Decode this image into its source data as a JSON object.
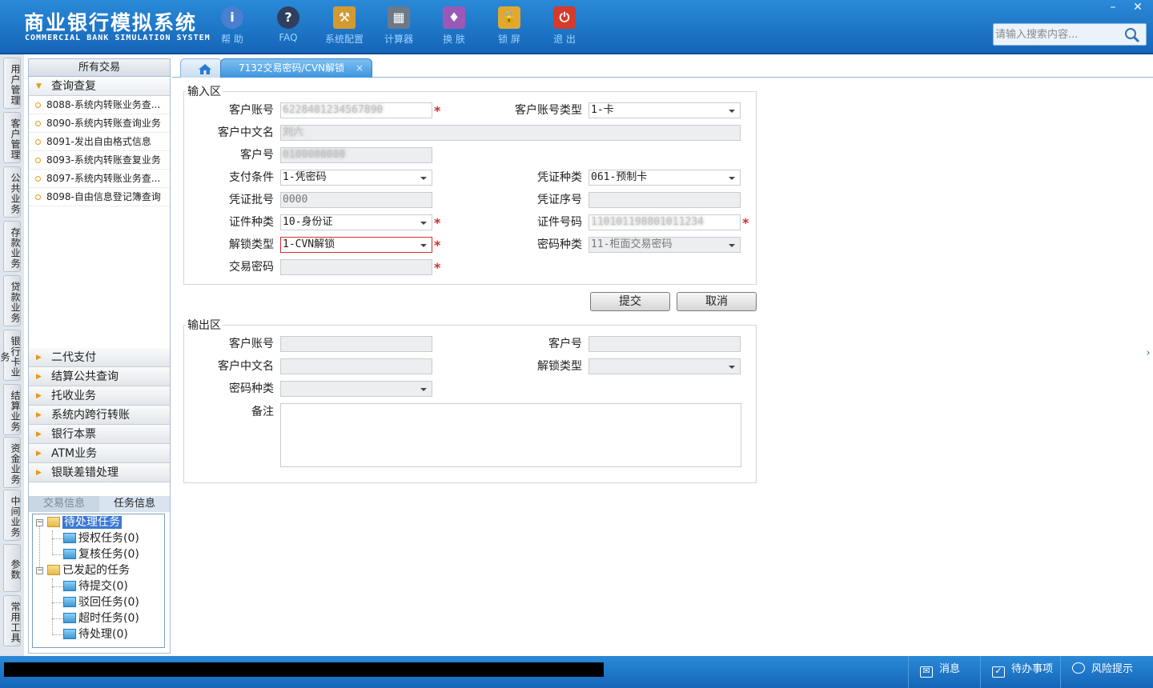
{
  "header": {
    "title": "商业银行模拟系统",
    "subtitle": "COMMERCIAL BANK SIMULATION SYSTEM",
    "toolbar": [
      {
        "label": "帮 助",
        "icon": "help-icon",
        "glyph": "i",
        "color": "#4a7fd0"
      },
      {
        "label": "FAQ",
        "icon": "faq-icon",
        "glyph": "?",
        "color": "#2f3f5e"
      },
      {
        "label": "系统配置",
        "icon": "toolbox-icon",
        "glyph": "⚒",
        "color": "#d39a32"
      },
      {
        "label": "计算器",
        "icon": "calculator-icon",
        "glyph": "▦",
        "color": "#6c7a88"
      },
      {
        "label": "换 肤",
        "icon": "skin-icon",
        "glyph": "♦",
        "color": "#9b59b6"
      },
      {
        "label": "锁 屏",
        "icon": "lock-icon",
        "glyph": "🔒",
        "color": "#e0a830"
      },
      {
        "label": "退 出",
        "icon": "exit-icon",
        "glyph": "⏻",
        "color": "#d63a2a"
      }
    ],
    "search_placeholder": "请输入搜索内容..."
  },
  "vertical_tabs": [
    "用户管理",
    "客户管理",
    "公共业务",
    "存款业务",
    "贷款业务",
    "银行卡业务",
    "结算业务",
    "资金业务",
    "中间业务",
    "参数",
    "常用工具"
  ],
  "menu": {
    "header": "所有交易",
    "open_group": "查询查复",
    "items": [
      "8088-系统内转账业务查...",
      "8090-系统内转账查询业务",
      "8091-发出自由格式信息",
      "8093-系统内转账查复业务",
      "8097-系统内转账业务查...",
      "8098-自由信息登记簿查询"
    ],
    "groups": [
      "二代支付",
      "结算公共查询",
      "托收业务",
      "系统内跨行转账",
      "银行本票",
      "ATM业务",
      "银联差错处理"
    ],
    "sub_tabs": {
      "trade": "交易信息",
      "task": "任务信息"
    },
    "tree": {
      "pending": "待处理任务",
      "auth": "授权任务(0)",
      "review": "复核任务(0)",
      "initiated": "已发起的任务",
      "to_submit": "待提交(0)",
      "rejected": "驳回任务(0)",
      "timeout": "超时任务(0)",
      "to_process": "待处理(0)"
    }
  },
  "tabs": {
    "active": "7132交易密码/CVN解锁",
    "close": "×"
  },
  "input_section": {
    "legend": "输入区",
    "fields": {
      "account_label": "客户账号",
      "account_value": "6228481234567890",
      "account_type_label": "客户账号类型",
      "account_type_value": "1-卡",
      "cn_name_label": "客户中文名",
      "cn_name_value": "刘六",
      "customer_no_label": "客户号",
      "customer_no_value": "0100000000",
      "pay_cond_label": "支付条件",
      "pay_cond_value": "1-凭密码",
      "voucher_type_label": "凭证种类",
      "voucher_type_value": "061-预制卡",
      "voucher_batch_label": "凭证批号",
      "voucher_batch_value": "0000",
      "voucher_seq_label": "凭证序号",
      "voucher_seq_value": "",
      "id_type_label": "证件种类",
      "id_type_value": "10-身份证",
      "id_no_label": "证件号码",
      "id_no_value": "110101198801011234",
      "unlock_type_label": "解锁类型",
      "unlock_type_value": "1-CVN解锁",
      "pwd_type_label": "密码种类",
      "pwd_type_value": "11-柜面交易密码",
      "trade_pwd_label": "交易密码",
      "trade_pwd_value": ""
    },
    "required_mark": "*"
  },
  "buttons": {
    "submit": "提交",
    "cancel": "取消"
  },
  "output_section": {
    "legend": "输出区",
    "account_label": "客户账号",
    "customer_no_label": "客户号",
    "cn_name_label": "客户中文名",
    "unlock_type_label": "解锁类型",
    "pwd_type_label": "密码种类",
    "remark_label": "备注"
  },
  "statusbar": {
    "message": "消息",
    "todo": "待办事项",
    "risk": "风险提示"
  }
}
